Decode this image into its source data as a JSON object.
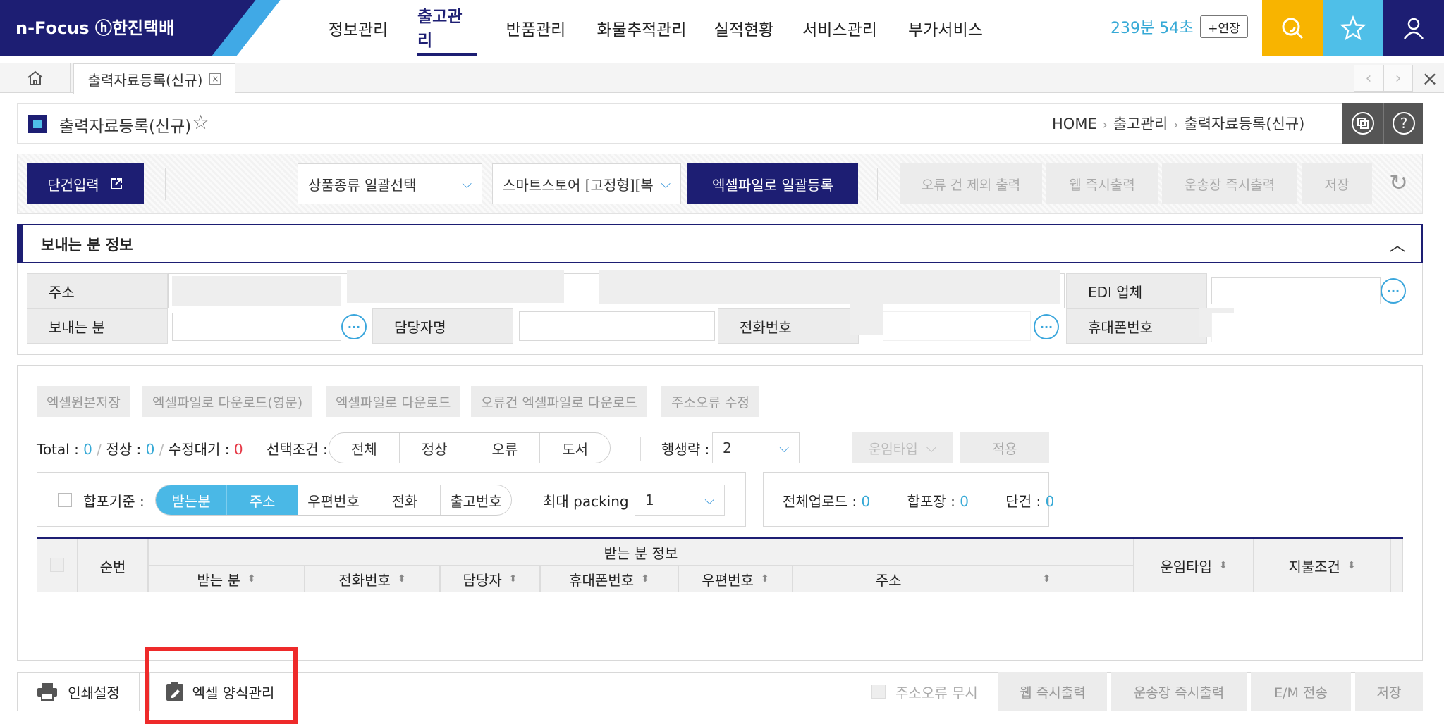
{
  "header": {
    "logo": "n-Focus ⓗ한진택배",
    "nav": [
      "정보관리",
      "출고관리",
      "반품관리",
      "화물추적관리",
      "실적현황",
      "서비스관리",
      "부가서비스"
    ],
    "active_nav": "출고관리",
    "timer": "239분 54초",
    "extend_label": "+연장",
    "icons": {
      "search": "search-icon",
      "favorite": "star-icon",
      "user": "user-icon"
    },
    "colors": {
      "brand": "#1d1e73",
      "accent": "#40a9e6",
      "search_bg": "#f8b400",
      "fav_bg": "#4fbfe8"
    }
  },
  "tabs": {
    "current": "출력자료등록(신규)"
  },
  "page": {
    "title": "출력자료등록(신규)",
    "breadcrumb": [
      "HOME",
      "출고관리",
      "출력자료등록(신규)"
    ]
  },
  "toolbar": {
    "single_input": "단건입력",
    "product_type": "상품종류 일괄선택",
    "store": "스마트스토어 [고정형][복",
    "excel_register": "엑셀파일로 일괄등록",
    "exclude_error_print": "오류 건 제외 출력",
    "web_print": "웹 즉시출력",
    "waybill_print": "운송장 즉시출력",
    "save": "저장"
  },
  "sender": {
    "title": "보내는 분 정보",
    "address_label": "주소",
    "edi_label": "EDI 업체",
    "sender_label": "보내는 분",
    "manager_label": "담당자명",
    "phone_label": "전화번호",
    "mobile_label": "휴대폰번호"
  },
  "upload": {
    "buttons": [
      "엑셀원본저장",
      "엑셀파일로 다운로드(영문)",
      "엑셀파일로 다운로드",
      "오류건 엑셀파일로 다운로드",
      "주소오류 수정"
    ],
    "total_label": "Total : ",
    "total": "0",
    "normal_label": "정상 : ",
    "normal": "0",
    "pending_label": "수정대기 : ",
    "pending": "0",
    "cond_label": "선택조건 :",
    "cond_options": [
      "전체",
      "정상",
      "오류",
      "도서"
    ],
    "rows_label": "행생략 :",
    "rows_value": "2",
    "freight_type": "운임타입",
    "apply": "적용",
    "merge_label": "합포기준 :",
    "merge_options": [
      "받는분",
      "주소",
      "우편번호",
      "전화",
      "출고번호"
    ],
    "max_packing_label": "최대 packing :",
    "max_packing_value": "1",
    "all_upload_label": "전체업로드 : ",
    "all_upload": "0",
    "merge_count_label": "합포장 : ",
    "merge_count": "0",
    "single_count_label": "단건 : ",
    "single_count": "0"
  },
  "table": {
    "seq": "순번",
    "receiver_group": "받는 분 정보",
    "columns": [
      "받는 분",
      "전화번호",
      "담당자",
      "휴대폰번호",
      "우편번호",
      "주소"
    ],
    "freight_type": "운임타입",
    "payment": "지불조건"
  },
  "bottom": {
    "print_settings": "인쇄설정",
    "excel_format": "엑셀 양식관리",
    "ignore_address_error": "주소오류 무시",
    "web_print": "웹 즉시출력",
    "waybill_print": "운송장 즉시출력",
    "em_send": "E/M 전송",
    "save": "저장"
  }
}
